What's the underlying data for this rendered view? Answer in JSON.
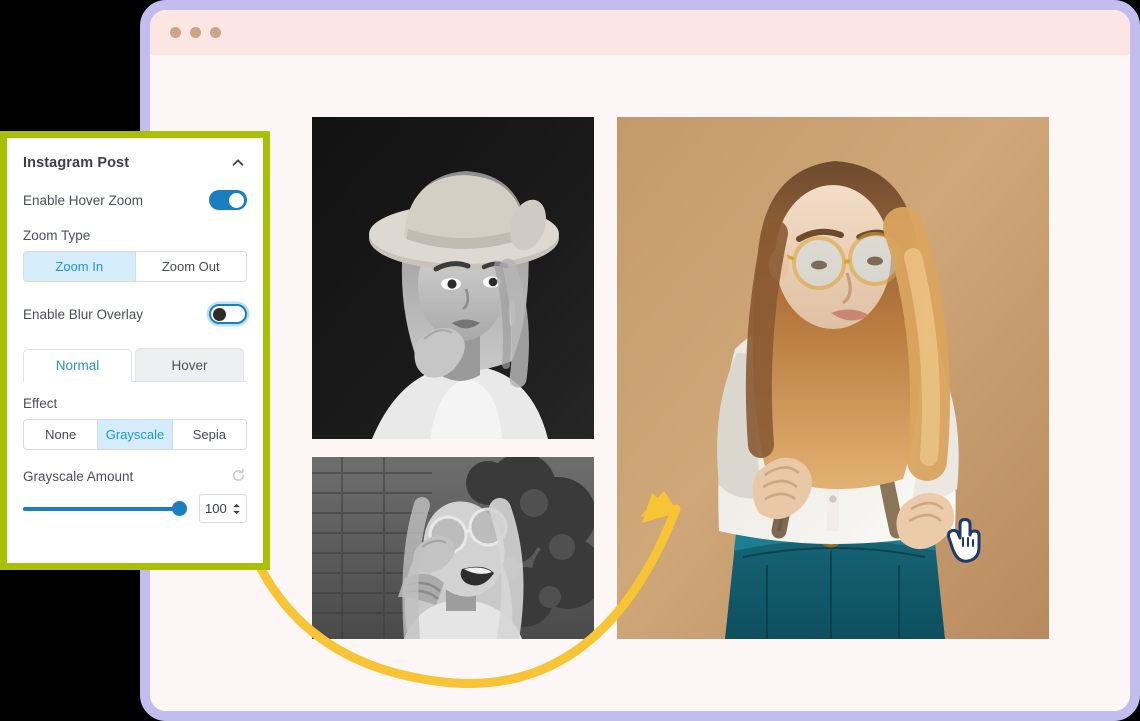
{
  "browser": {
    "window_dots": [
      "dot-red",
      "dot-yellow",
      "dot-green"
    ],
    "titlebar_color": "#fce6e3",
    "frame_color": "#c3bdee",
    "page_bg": "#fdf6f6"
  },
  "panel": {
    "title": "Instagram Post",
    "collapse_icon": "chevron-up-icon",
    "highlight_border_color": "#a9bf08",
    "accent_color": "#1a7fc1",
    "selected_bg_color": "#d5ecfb",
    "rows": {
      "hover_zoom": {
        "label": "Enable Hover Zoom",
        "toggle_state": "on"
      },
      "blur_overlay": {
        "label": "Enable Blur Overlay",
        "toggle_state": "off"
      }
    },
    "zoom_type": {
      "label": "Zoom Type",
      "options": [
        "Zoom In",
        "Zoom Out"
      ],
      "selected": "Zoom In"
    },
    "tabs": {
      "items": [
        "Normal",
        "Hover"
      ],
      "selected": "Normal"
    },
    "effect": {
      "label": "Effect",
      "options": [
        "None",
        "Grayscale",
        "Sepia"
      ],
      "selected": "Grayscale"
    },
    "grayscale_amount": {
      "label": "Grayscale Amount",
      "reset_icon": "reset-icon",
      "value": "100",
      "slider_percent": 100,
      "min": 0,
      "max": 100
    }
  },
  "gallery": {
    "items": [
      {
        "name": "photo-woman-hat-grayscale",
        "filter": "grayscale",
        "description": "Woman in wide-brim hat, black background"
      },
      {
        "name": "photo-woman-sunglasses-grayscale",
        "filter": "grayscale",
        "description": "Laughing woman with round sunglasses against brick wall"
      },
      {
        "name": "photo-woman-suspenders-color",
        "filter": "none",
        "description": "Woman with glasses and suspenders on tan backdrop"
      }
    ]
  },
  "annotations": {
    "arrow": {
      "name": "curved-arrow-annotation",
      "color": "#f7c435"
    },
    "cursor": {
      "name": "hand-pointer-cursor",
      "fill": "#ffffff",
      "stroke": "#1f3a6e"
    }
  }
}
